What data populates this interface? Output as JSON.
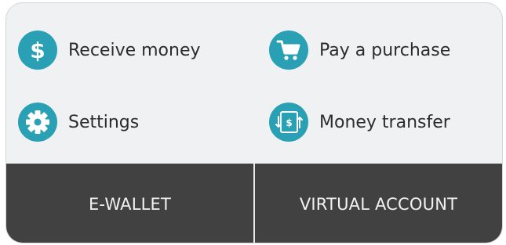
{
  "actions": [
    {
      "label": "Receive money",
      "icon": "dollar-icon"
    },
    {
      "label": "Pay a purchase",
      "icon": "shopping-cart-icon"
    },
    {
      "label": "Settings",
      "icon": "gear-icon"
    },
    {
      "label": "Money transfer",
      "icon": "money-transfer-icon"
    }
  ],
  "tabs": [
    {
      "label": "E-WALLET"
    },
    {
      "label": "VIRTUAL ACCOUNT"
    }
  ],
  "colors": {
    "accent": "#2aa0b4",
    "card_background": "#f0f1f3",
    "tab_bar": "#414141",
    "text": "#2c2c2c",
    "tab_text": "#f2f2f2"
  }
}
